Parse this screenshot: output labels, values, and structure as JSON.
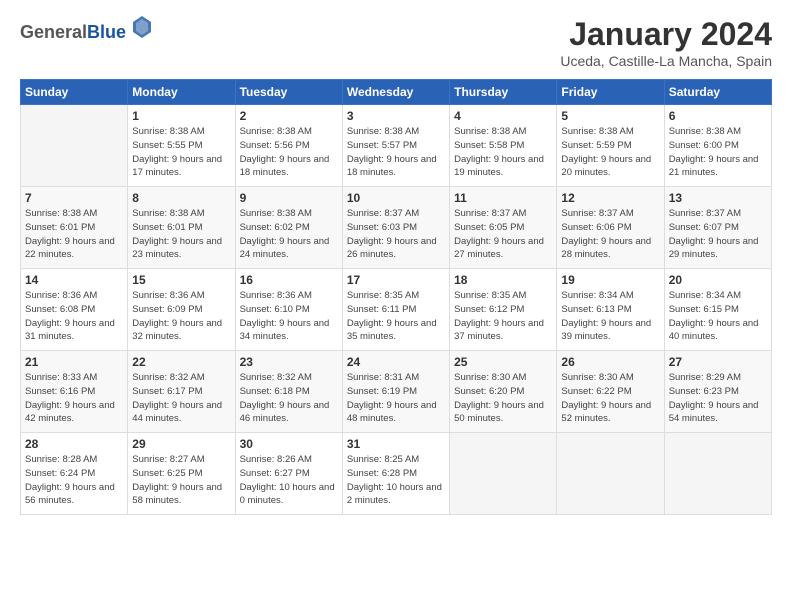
{
  "logo": {
    "general": "General",
    "blue": "Blue"
  },
  "title": "January 2024",
  "location": "Uceda, Castille-La Mancha, Spain",
  "days_of_week": [
    "Sunday",
    "Monday",
    "Tuesday",
    "Wednesday",
    "Thursday",
    "Friday",
    "Saturday"
  ],
  "weeks": [
    [
      {
        "day": "",
        "sunrise": "",
        "sunset": "",
        "daylight": ""
      },
      {
        "day": "1",
        "sunrise": "Sunrise: 8:38 AM",
        "sunset": "Sunset: 5:55 PM",
        "daylight": "Daylight: 9 hours and 17 minutes."
      },
      {
        "day": "2",
        "sunrise": "Sunrise: 8:38 AM",
        "sunset": "Sunset: 5:56 PM",
        "daylight": "Daylight: 9 hours and 18 minutes."
      },
      {
        "day": "3",
        "sunrise": "Sunrise: 8:38 AM",
        "sunset": "Sunset: 5:57 PM",
        "daylight": "Daylight: 9 hours and 18 minutes."
      },
      {
        "day": "4",
        "sunrise": "Sunrise: 8:38 AM",
        "sunset": "Sunset: 5:58 PM",
        "daylight": "Daylight: 9 hours and 19 minutes."
      },
      {
        "day": "5",
        "sunrise": "Sunrise: 8:38 AM",
        "sunset": "Sunset: 5:59 PM",
        "daylight": "Daylight: 9 hours and 20 minutes."
      },
      {
        "day": "6",
        "sunrise": "Sunrise: 8:38 AM",
        "sunset": "Sunset: 6:00 PM",
        "daylight": "Daylight: 9 hours and 21 minutes."
      }
    ],
    [
      {
        "day": "7",
        "sunrise": "Sunrise: 8:38 AM",
        "sunset": "Sunset: 6:01 PM",
        "daylight": "Daylight: 9 hours and 22 minutes."
      },
      {
        "day": "8",
        "sunrise": "Sunrise: 8:38 AM",
        "sunset": "Sunset: 6:01 PM",
        "daylight": "Daylight: 9 hours and 23 minutes."
      },
      {
        "day": "9",
        "sunrise": "Sunrise: 8:38 AM",
        "sunset": "Sunset: 6:02 PM",
        "daylight": "Daylight: 9 hours and 24 minutes."
      },
      {
        "day": "10",
        "sunrise": "Sunrise: 8:37 AM",
        "sunset": "Sunset: 6:03 PM",
        "daylight": "Daylight: 9 hours and 26 minutes."
      },
      {
        "day": "11",
        "sunrise": "Sunrise: 8:37 AM",
        "sunset": "Sunset: 6:05 PM",
        "daylight": "Daylight: 9 hours and 27 minutes."
      },
      {
        "day": "12",
        "sunrise": "Sunrise: 8:37 AM",
        "sunset": "Sunset: 6:06 PM",
        "daylight": "Daylight: 9 hours and 28 minutes."
      },
      {
        "day": "13",
        "sunrise": "Sunrise: 8:37 AM",
        "sunset": "Sunset: 6:07 PM",
        "daylight": "Daylight: 9 hours and 29 minutes."
      }
    ],
    [
      {
        "day": "14",
        "sunrise": "Sunrise: 8:36 AM",
        "sunset": "Sunset: 6:08 PM",
        "daylight": "Daylight: 9 hours and 31 minutes."
      },
      {
        "day": "15",
        "sunrise": "Sunrise: 8:36 AM",
        "sunset": "Sunset: 6:09 PM",
        "daylight": "Daylight: 9 hours and 32 minutes."
      },
      {
        "day": "16",
        "sunrise": "Sunrise: 8:36 AM",
        "sunset": "Sunset: 6:10 PM",
        "daylight": "Daylight: 9 hours and 34 minutes."
      },
      {
        "day": "17",
        "sunrise": "Sunrise: 8:35 AM",
        "sunset": "Sunset: 6:11 PM",
        "daylight": "Daylight: 9 hours and 35 minutes."
      },
      {
        "day": "18",
        "sunrise": "Sunrise: 8:35 AM",
        "sunset": "Sunset: 6:12 PM",
        "daylight": "Daylight: 9 hours and 37 minutes."
      },
      {
        "day": "19",
        "sunrise": "Sunrise: 8:34 AM",
        "sunset": "Sunset: 6:13 PM",
        "daylight": "Daylight: 9 hours and 39 minutes."
      },
      {
        "day": "20",
        "sunrise": "Sunrise: 8:34 AM",
        "sunset": "Sunset: 6:15 PM",
        "daylight": "Daylight: 9 hours and 40 minutes."
      }
    ],
    [
      {
        "day": "21",
        "sunrise": "Sunrise: 8:33 AM",
        "sunset": "Sunset: 6:16 PM",
        "daylight": "Daylight: 9 hours and 42 minutes."
      },
      {
        "day": "22",
        "sunrise": "Sunrise: 8:32 AM",
        "sunset": "Sunset: 6:17 PM",
        "daylight": "Daylight: 9 hours and 44 minutes."
      },
      {
        "day": "23",
        "sunrise": "Sunrise: 8:32 AM",
        "sunset": "Sunset: 6:18 PM",
        "daylight": "Daylight: 9 hours and 46 minutes."
      },
      {
        "day": "24",
        "sunrise": "Sunrise: 8:31 AM",
        "sunset": "Sunset: 6:19 PM",
        "daylight": "Daylight: 9 hours and 48 minutes."
      },
      {
        "day": "25",
        "sunrise": "Sunrise: 8:30 AM",
        "sunset": "Sunset: 6:20 PM",
        "daylight": "Daylight: 9 hours and 50 minutes."
      },
      {
        "day": "26",
        "sunrise": "Sunrise: 8:30 AM",
        "sunset": "Sunset: 6:22 PM",
        "daylight": "Daylight: 9 hours and 52 minutes."
      },
      {
        "day": "27",
        "sunrise": "Sunrise: 8:29 AM",
        "sunset": "Sunset: 6:23 PM",
        "daylight": "Daylight: 9 hours and 54 minutes."
      }
    ],
    [
      {
        "day": "28",
        "sunrise": "Sunrise: 8:28 AM",
        "sunset": "Sunset: 6:24 PM",
        "daylight": "Daylight: 9 hours and 56 minutes."
      },
      {
        "day": "29",
        "sunrise": "Sunrise: 8:27 AM",
        "sunset": "Sunset: 6:25 PM",
        "daylight": "Daylight: 9 hours and 58 minutes."
      },
      {
        "day": "30",
        "sunrise": "Sunrise: 8:26 AM",
        "sunset": "Sunset: 6:27 PM",
        "daylight": "Daylight: 10 hours and 0 minutes."
      },
      {
        "day": "31",
        "sunrise": "Sunrise: 8:25 AM",
        "sunset": "Sunset: 6:28 PM",
        "daylight": "Daylight: 10 hours and 2 minutes."
      },
      {
        "day": "",
        "sunrise": "",
        "sunset": "",
        "daylight": ""
      },
      {
        "day": "",
        "sunrise": "",
        "sunset": "",
        "daylight": ""
      },
      {
        "day": "",
        "sunrise": "",
        "sunset": "",
        "daylight": ""
      }
    ]
  ]
}
